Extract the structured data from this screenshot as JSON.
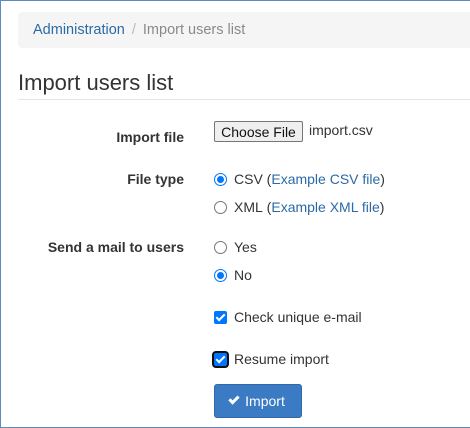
{
  "breadcrumb": {
    "parent": "Administration",
    "separator": "/",
    "current": "Import users list"
  },
  "page": {
    "title": "Import users list"
  },
  "form": {
    "import_file": {
      "label": "Import file",
      "button_label": "Choose File",
      "file_name": "import.csv"
    },
    "file_type": {
      "label": "File type",
      "options": [
        {
          "value": "CSV",
          "open_paren": " (",
          "link": "Example CSV file",
          "close_paren": ")",
          "selected": true
        },
        {
          "value": "XML",
          "open_paren": " (",
          "link": "Example XML file",
          "close_paren": ")",
          "selected": false
        }
      ]
    },
    "send_mail": {
      "label": "Send a mail to users",
      "options": [
        {
          "value": "Yes",
          "selected": false
        },
        {
          "value": "No",
          "selected": true
        }
      ]
    },
    "check_unique_email": {
      "label": "Check unique e-mail",
      "checked": true
    },
    "resume_import": {
      "label": "Resume import",
      "checked": true
    },
    "submit": {
      "label": "Import",
      "icon": "check-icon"
    }
  },
  "colors": {
    "link": "#2c6aa6",
    "primary_button": "#3a7bc3",
    "control_accent": "#0075ff",
    "frame_border": "#5b8bbf"
  }
}
